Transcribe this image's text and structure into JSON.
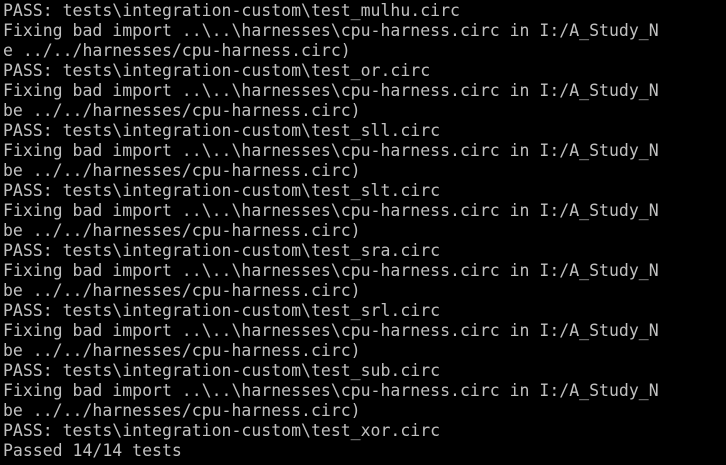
{
  "terminal": {
    "lines": [
      "PASS: tests\\integration-custom\\test_mulhu.circ",
      "Fixing bad import ..\\..\\harnesses\\cpu-harness.circ in I:/A_Study_N",
      "e ../../harnesses/cpu-harness.circ)",
      "PASS: tests\\integration-custom\\test_or.circ",
      "Fixing bad import ..\\..\\harnesses\\cpu-harness.circ in I:/A_Study_N",
      "be ../../harnesses/cpu-harness.circ)",
      "PASS: tests\\integration-custom\\test_sll.circ",
      "Fixing bad import ..\\..\\harnesses\\cpu-harness.circ in I:/A_Study_N",
      "be ../../harnesses/cpu-harness.circ)",
      "PASS: tests\\integration-custom\\test_slt.circ",
      "Fixing bad import ..\\..\\harnesses\\cpu-harness.circ in I:/A_Study_N",
      "be ../../harnesses/cpu-harness.circ)",
      "PASS: tests\\integration-custom\\test_sra.circ",
      "Fixing bad import ..\\..\\harnesses\\cpu-harness.circ in I:/A_Study_N",
      "be ../../harnesses/cpu-harness.circ)",
      "PASS: tests\\integration-custom\\test_srl.circ",
      "Fixing bad import ..\\..\\harnesses\\cpu-harness.circ in I:/A_Study_N",
      "be ../../harnesses/cpu-harness.circ)",
      "PASS: tests\\integration-custom\\test_sub.circ",
      "Fixing bad import ..\\..\\harnesses\\cpu-harness.circ in I:/A_Study_N",
      "be ../../harnesses/cpu-harness.circ)",
      "PASS: tests\\integration-custom\\test_xor.circ",
      "Passed 14/14 tests"
    ]
  },
  "colors": {
    "background": "#000000",
    "text": "#c0c0c0"
  }
}
